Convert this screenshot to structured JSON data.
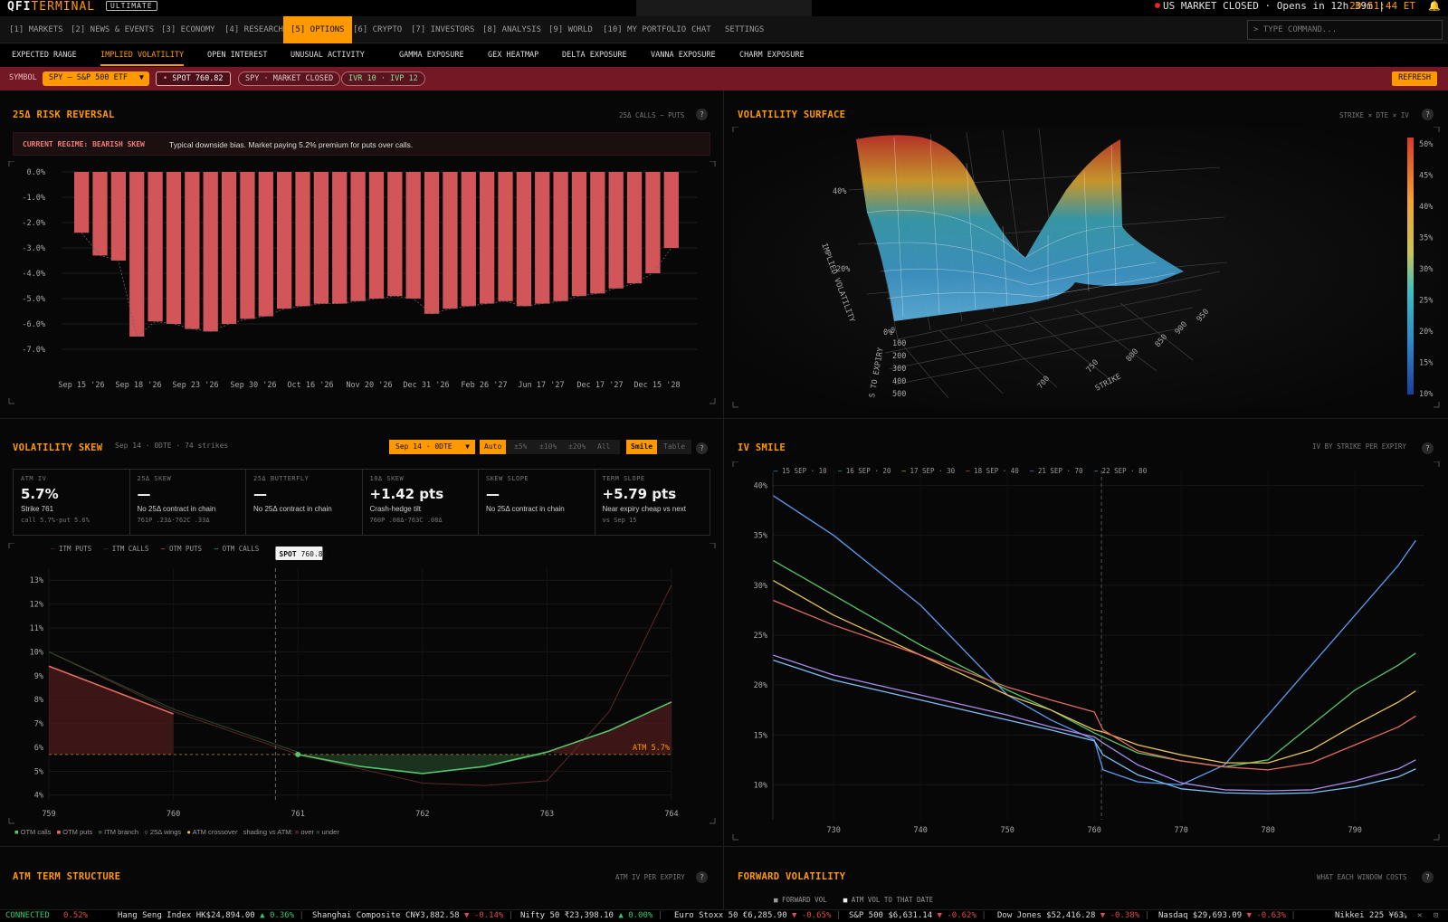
{
  "app": {
    "logo_a": "QFI",
    "logo_b": "TERMINAL",
    "tier": "ULTIMATE",
    "market_status": "US MARKET CLOSED · Opens in 12h 39m |",
    "clock": "20:51:44 ET",
    "command_placeholder": "> TYPE COMMAND..."
  },
  "nav": [
    {
      "label": "[1] MARKETS"
    },
    {
      "label": "[2] NEWS & EVENTS"
    },
    {
      "label": "[3] ECONOMY"
    },
    {
      "label": "[4] RESEARCH"
    },
    {
      "label": "[5] OPTIONS",
      "active": true
    },
    {
      "label": "[6] CRYPTO"
    },
    {
      "label": "[7] INVESTORS"
    },
    {
      "label": "[8] ANALYSIS"
    },
    {
      "label": "[9] WORLD"
    },
    {
      "label": "[10] MY PORTFOLIO"
    },
    {
      "label": "CHAT"
    },
    {
      "label": "SETTINGS"
    }
  ],
  "subnav": [
    {
      "label": "EXPECTED RANGE"
    },
    {
      "label": "IMPLIED VOLATILITY",
      "active": true
    },
    {
      "label": "OPEN INTEREST"
    },
    {
      "label": "UNUSUAL ACTIVITY"
    },
    {
      "label": "GAMMA EXPOSURE"
    },
    {
      "label": "GEX HEATMAP"
    },
    {
      "label": "DELTA EXPOSURE"
    },
    {
      "label": "VANNA EXPOSURE"
    },
    {
      "label": "CHARM EXPOSURE"
    }
  ],
  "symbolbar": {
    "symbol_label": "SYMBOL",
    "symbol_value": "SPY — S&P 500 ETF",
    "spot": "SPOT 760.82",
    "market": "SPY · MARKET CLOSED",
    "ivr": "IVR 10 · IVP 12",
    "refresh": "REFRESH"
  },
  "risk_reversal": {
    "title": "25Δ RISK REVERSAL",
    "hint": "25Δ CALLS − PUTS",
    "regime_label": "CURRENT REGIME: BEARISH SKEW",
    "regime_text": "Typical downside bias. Market paying 5.2% premium for puts over calls."
  },
  "vol_surface": {
    "title": "VOLATILITY SURFACE",
    "hint": "STRIKE × DTE × IV",
    "z_label": "IMPLIED VOLATILITY",
    "z_ticks": [
      "40%",
      "20%",
      "0%"
    ],
    "y_label": "S TO EXPIRY",
    "y_ticks": [
      "0",
      "100",
      "200",
      "300",
      "400",
      "500"
    ],
    "x_label": "STRIKE",
    "x_ticks": [
      "700",
      "750",
      "800",
      "850",
      "900",
      "950"
    ],
    "colorbar": [
      "50%",
      "45%",
      "40%",
      "35%",
      "30%",
      "25%",
      "20%",
      "15%",
      "10%"
    ]
  },
  "vol_skew": {
    "title": "VOLATILITY SKEW",
    "subtitle": "Sep 14 · 0DTE · 74 strikes",
    "expiry": "Sep 14 · 0DTE",
    "ranges": [
      "Auto",
      "±5%",
      "±10%",
      "±20%",
      "All"
    ],
    "views": [
      "Smile",
      "Table"
    ],
    "metrics": [
      {
        "label": "ATM IV",
        "value": "5.7%",
        "sub": "Strike 761",
        "sub2": "call 5.7%·put 5.6%"
      },
      {
        "label": "25Δ SKEW",
        "value": "—",
        "sub": "No 25Δ contract in chain",
        "sub2": "761P .23Δ·762C .33Δ"
      },
      {
        "label": "25Δ BUTTERFLY",
        "value": "—",
        "sub": "No 25Δ contract in chain",
        "sub2": ""
      },
      {
        "label": "10Δ SKEW",
        "value": "+1.42 pts",
        "sub": "Crash-hedge tilt",
        "sub2": "760P .08Δ·763C .08Δ"
      },
      {
        "label": "SKEW SLOPE",
        "value": "—",
        "sub": "No 25Δ contract in chain",
        "sub2": ""
      },
      {
        "label": "TERM SLOPE",
        "value": "+5.79 pts",
        "sub": "Near expiry cheap vs next",
        "sub2": "vs Sep 15"
      }
    ],
    "legend_top": [
      "ITM PUTS",
      "ITM CALLS",
      "OTM PUTS",
      "OTM CALLS"
    ],
    "spot_label": "SPOT",
    "spot_value": "760.82",
    "atm_label": "ATM 5.7%",
    "legend_bottom": [
      "OTM calls",
      "OTM puts",
      "ITM branch",
      "25Δ wings",
      "ATM crossover",
      "shading vs ATM:",
      "over",
      "under"
    ]
  },
  "iv_smile": {
    "title": "IV SMILE",
    "hint": "IV BY STRIKE PER EXPIRY"
  },
  "atm_term": {
    "title": "ATM TERM STRUCTURE",
    "hint": "ATM IV PER EXPIRY"
  },
  "fwd_vol": {
    "title": "FORWARD VOLATILITY",
    "hint": "WHAT EACH WINDOW COSTS",
    "legend": [
      "FORWARD VOL",
      "ATM VOL TO THAT DATE"
    ]
  },
  "ticker": {
    "status": "CONNECTED",
    "items": [
      {
        "text": "0.52%",
        "dir": "down"
      },
      {
        "text": "Hang Seng Index HK$24,894.00",
        "chg": "▲ 0.36%",
        "dir": "up"
      },
      {
        "text": "Shanghai Composite CN¥3,882.58",
        "chg": "▼ -0.14%",
        "dir": "down"
      },
      {
        "text": "Nifty 50 ₹23,398.10",
        "chg": "▲ 0.00%",
        "dir": "up"
      },
      {
        "text": "Euro Stoxx 50 €6,285.90",
        "chg": "▼ -0.65%",
        "dir": "down"
      },
      {
        "text": "S&P 500 $6,631.14",
        "chg": "▼ -0.62%",
        "dir": "down"
      },
      {
        "text": "Dow Jones $52,416.28",
        "chg": "▼ -0.38%",
        "dir": "down"
      },
      {
        "text": "Nasdaq $29,693.09",
        "chg": "▼ -0.63%",
        "dir": "down"
      },
      {
        "text": "Nikkei 225 ¥63,",
        "chg": "",
        "dir": "up"
      }
    ]
  },
  "chart_data": [
    {
      "type": "bar",
      "title": "25Δ RISK REVERSAL",
      "tick_labels_x": [
        "Sep 15 '26",
        "Sep 18 '26",
        "Sep 23 '26",
        "Sep 30 '26",
        "Oct 16 '26",
        "Nov 20 '26",
        "Dec 31 '26",
        "Feb 26 '27",
        "Jun 17 '27",
        "Dec 17 '27",
        "Dec 15 '28"
      ],
      "y_ticks": [
        "0.0%",
        "-1.0%",
        "-2.0%",
        "-3.0%",
        "-4.0%",
        "-5.0%",
        "-6.0%",
        "-7.0%"
      ],
      "ylim": [
        -7.5,
        0
      ],
      "values": [
        -2.4,
        -3.3,
        -3.5,
        -6.5,
        -5.9,
        -6.0,
        -6.2,
        -6.3,
        -6.0,
        -5.8,
        -5.7,
        -5.4,
        -5.3,
        -5.2,
        -5.2,
        -5.1,
        -5.0,
        -4.9,
        -5.0,
        -5.6,
        -5.4,
        -5.3,
        -5.2,
        -5.1,
        -5.3,
        -5.2,
        -5.1,
        -4.9,
        -4.8,
        -4.6,
        -4.4,
        -4.0,
        -3.0
      ]
    },
    {
      "type": "line",
      "title": "VOLATILITY SKEW",
      "x_ticks": [
        "759",
        "760",
        "761",
        "762",
        "763",
        "764"
      ],
      "y_ticks": [
        "13%",
        "12%",
        "11%",
        "10%",
        "9%",
        "8%",
        "7%",
        "6%",
        "5%",
        "4%"
      ],
      "xlim": [
        759,
        764
      ],
      "ylim": [
        3.8,
        13.5
      ],
      "atm_iv": 5.7,
      "spot": 760.82,
      "series": [
        {
          "name": "OTM PUTS",
          "x": [
            759,
            760
          ],
          "y": [
            9.4,
            7.4
          ]
        },
        {
          "name": "ITM PUTS",
          "x": [
            759,
            760,
            761,
            762,
            762.5,
            763,
            763.5,
            764
          ],
          "y": [
            10.0,
            7.5,
            5.7,
            4.5,
            4.4,
            4.6,
            7.5,
            12.8
          ]
        },
        {
          "name": "ITM CALLS",
          "x": [
            759,
            760,
            761
          ],
          "y": [
            10.0,
            7.6,
            5.8
          ]
        },
        {
          "name": "OTM CALLS",
          "x": [
            761,
            761.5,
            762,
            762.5,
            763,
            763.5,
            764
          ],
          "y": [
            5.7,
            5.2,
            4.9,
            5.2,
            5.8,
            6.7,
            7.9
          ]
        }
      ]
    },
    {
      "type": "line",
      "title": "IV SMILE",
      "x_ticks": [
        "730",
        "740",
        "750",
        "760",
        "770",
        "780",
        "790"
      ],
      "y_ticks": [
        "40%",
        "35%",
        "30%",
        "25%",
        "20%",
        "15%",
        "10%"
      ],
      "xlim": [
        723,
        798
      ],
      "ylim": [
        6.5,
        41.5
      ],
      "x": [
        723,
        730,
        740,
        750,
        755,
        760,
        761,
        765,
        770,
        775,
        780,
        785,
        790,
        795,
        797
      ],
      "series": [
        {
          "name": "15 SEP · 10",
          "color": "#5b9bf0",
          "y": [
            39,
            35,
            28,
            19,
            16.5,
            14.5,
            11.5,
            10.3,
            10.0,
            12,
            17,
            22,
            27,
            32,
            34.5
          ]
        },
        {
          "name": "16 SEP · 20",
          "color": "#57c46b",
          "y": [
            32.5,
            29,
            24,
            19.5,
            17.5,
            15.2,
            14.8,
            13.2,
            12.4,
            11.8,
            12.5,
            16,
            19.5,
            22,
            23.2
          ]
        },
        {
          "name": "17 SEP · 30",
          "color": "#e8c15a",
          "y": [
            30.5,
            27,
            23,
            19,
            17.5,
            15.5,
            15.3,
            14,
            13,
            12.2,
            12.2,
            13.5,
            16,
            18.3,
            19.4
          ]
        },
        {
          "name": "18 SEP · 40",
          "color": "#e36a5e",
          "y": [
            28.5,
            26,
            23,
            19.8,
            18.5,
            17.3,
            15.5,
            13.4,
            12.4,
            11.8,
            11.5,
            12.2,
            14,
            15.8,
            16.9
          ]
        },
        {
          "name": "21 SEP · 70",
          "color": "#a78bea",
          "y": [
            23,
            21,
            19,
            17,
            15.8,
            14.8,
            14.2,
            12,
            10.2,
            9.5,
            9.4,
            9.5,
            10.4,
            11.6,
            12.5
          ]
        },
        {
          "name": "22 SEP · 80",
          "color": "#7cc0f5",
          "y": [
            22.5,
            20.5,
            18.5,
            16.5,
            15.5,
            14.4,
            13,
            11,
            9.6,
            9.2,
            9.1,
            9.2,
            9.8,
            10.8,
            11.6
          ]
        }
      ]
    }
  ]
}
